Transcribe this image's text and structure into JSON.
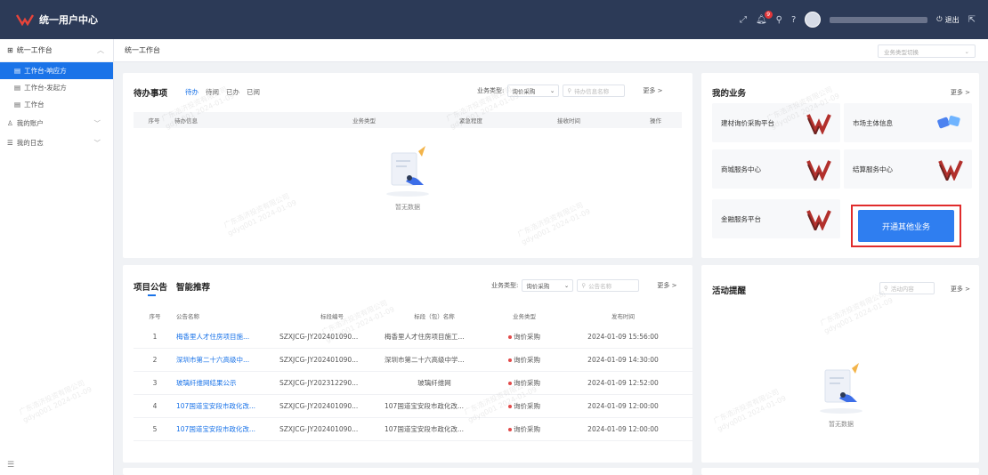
{
  "app": {
    "title": "统一用户中心"
  },
  "topbar": {
    "notif_count": "9",
    "logout_label": "退出"
  },
  "sidebar": {
    "section_workbench": "统一工作台",
    "items": [
      {
        "label": "工作台-响应方"
      },
      {
        "label": "工作台-发起方"
      },
      {
        "label": "工作台"
      }
    ],
    "section_account": "我的账户",
    "section_log": "我的日志"
  },
  "breadcrumb": {
    "current": "统一工作台",
    "biz_select_placeholder": "业务类型切换"
  },
  "todo": {
    "title": "待办事项",
    "tabs": [
      "待办",
      "待阅",
      "已办",
      "已阅"
    ],
    "filter_label": "业务类型:",
    "filter_value": "询价采购",
    "search_placeholder": "待办信息名称",
    "more": "更多 >",
    "columns": [
      "序号",
      "待办信息",
      "业务类型",
      "紧急程度",
      "接收时间",
      "操作"
    ],
    "empty": "暂无数据"
  },
  "my_biz": {
    "title": "我的业务",
    "more": "更多 >",
    "tiles": [
      {
        "name": "建材询价采购平台",
        "icon": "brand-logo-icon"
      },
      {
        "name": "市场主体信息",
        "icon": "puzzle-icon"
      },
      {
        "name": "商城服务中心",
        "icon": "brand-logo-icon"
      },
      {
        "name": "结算服务中心",
        "icon": "brand-logo-icon"
      },
      {
        "name": "金融服务平台",
        "icon": "brand-logo-icon"
      }
    ],
    "open_button": "开通其他业务"
  },
  "notice": {
    "title": "项目公告",
    "tab2": "智能推荐",
    "filter_label": "业务类型:",
    "filter_value": "询价采购",
    "search_placeholder": "公告名称",
    "more": "更多 >",
    "columns": [
      "序号",
      "公告名称",
      "标段编号",
      "标段（包）名称",
      "业务类型",
      "发布时间"
    ],
    "rows": [
      {
        "no": "1",
        "name": "梅香里人才住房项目施...",
        "code": "SZXJCG-JY202401090...",
        "section": "梅香里人才住房项目施工...",
        "type": "询价采购",
        "time": "2024-01-09 15:56:00"
      },
      {
        "no": "2",
        "name": "深圳市第二十六高级中...",
        "code": "SZXJCG-JY202401090...",
        "section": "深圳市第二十六高级中学...",
        "type": "询价采购",
        "time": "2024-01-09 14:30:00"
      },
      {
        "no": "3",
        "name": "玻璃纤维网结果公示",
        "code": "SZXJCG-JY202312290...",
        "section": "玻璃纤维网",
        "type": "询价采购",
        "time": "2024-01-09 12:52:00"
      },
      {
        "no": "4",
        "name": "107国道宝安段市政化改...",
        "code": "SZXJCG-JY202401090...",
        "section": "107国道宝安段市政化改...",
        "type": "询价采购",
        "time": "2024-01-09 12:00:00"
      },
      {
        "no": "5",
        "name": "107国道宝安段市政化改...",
        "code": "SZXJCG-JY202401090...",
        "section": "107国道宝安段市政化改...",
        "type": "询价采购",
        "time": "2024-01-09 12:00:00"
      }
    ]
  },
  "activity": {
    "title": "活动提醒",
    "search_placeholder": "活动内容",
    "more": "更多 >",
    "empty": "暂无数据"
  },
  "watermark": {
    "line1": "广东浩济投资有限公司",
    "line2": "gdyq001 2024-01-09"
  }
}
